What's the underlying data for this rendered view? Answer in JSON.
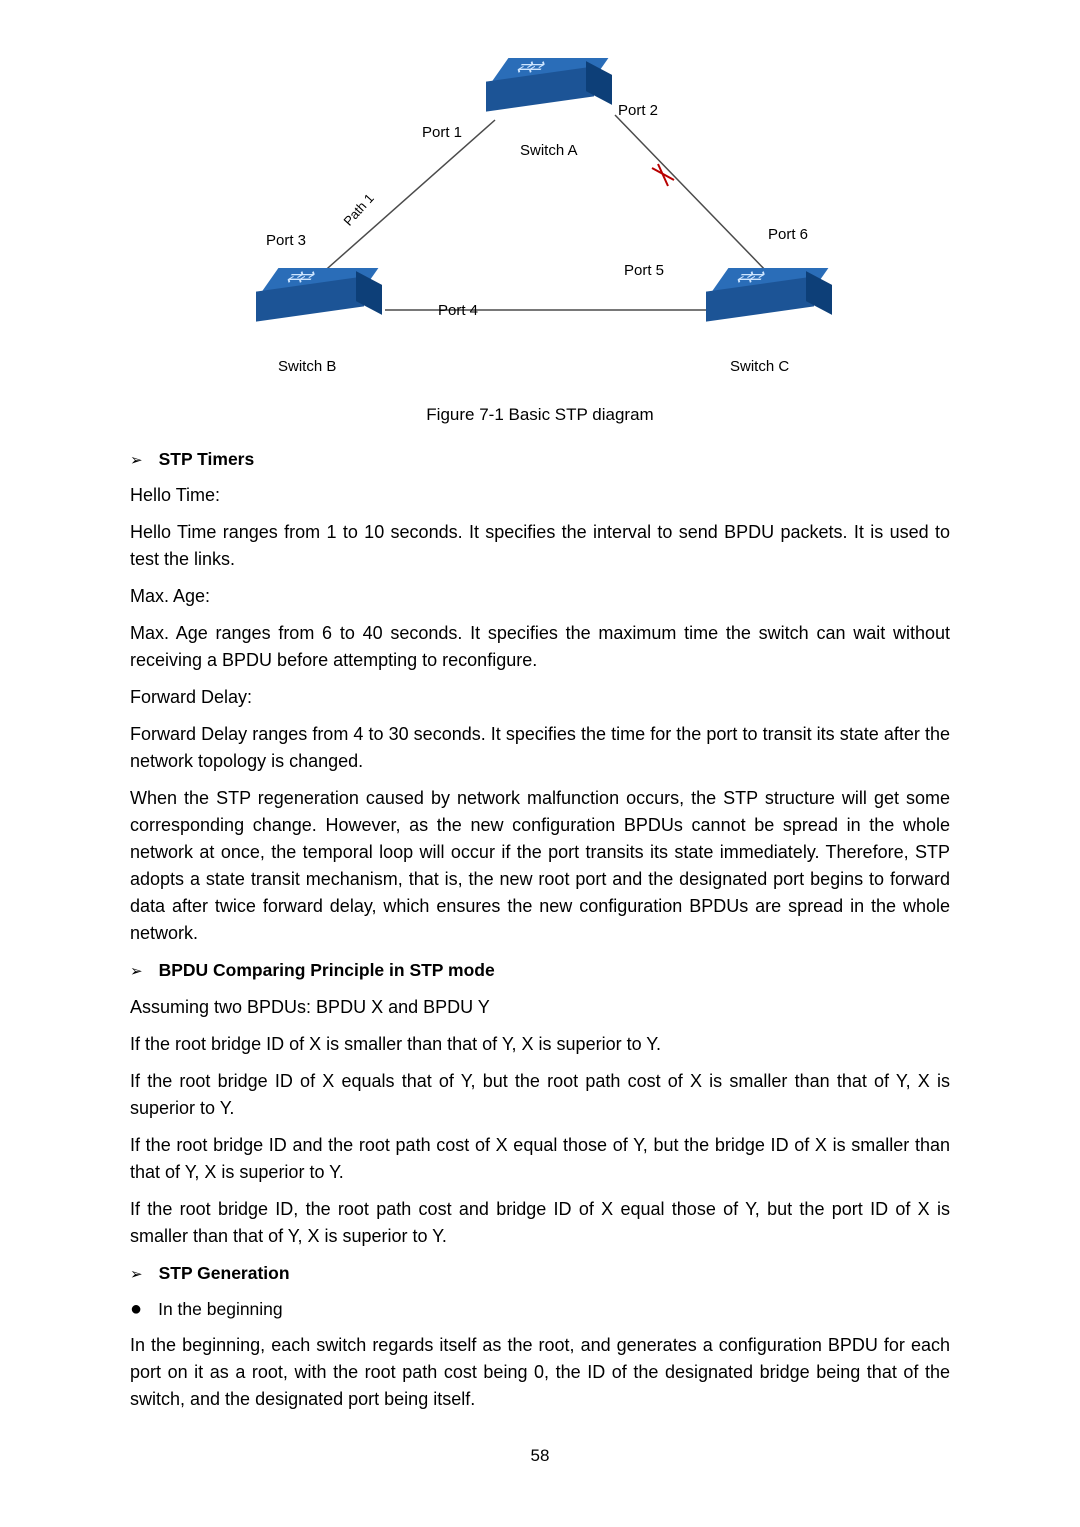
{
  "diagram": {
    "port1": "Port 1",
    "port2": "Port 2",
    "port3": "Port 3",
    "port4": "Port 4",
    "port5": "Port 5",
    "port6": "Port 6",
    "switchA": "Switch A",
    "switchB": "Switch B",
    "switchC": "Switch C",
    "path1": "Path 1"
  },
  "caption": "Figure 7-1 Basic STP diagram",
  "sec1": {
    "heading": "STP Timers",
    "hello_label": "Hello Time:",
    "hello_text": "Hello Time ranges from 1 to 10 seconds. It specifies the interval to send BPDU packets. It is used to test the links.",
    "maxage_label": "Max. Age:",
    "maxage_text": "Max. Age ranges from 6 to 40 seconds. It specifies the maximum time the switch can wait without receiving a BPDU before attempting to reconfigure.",
    "fwd_label": "Forward Delay:",
    "fwd_text": "Forward Delay ranges from 4 to 30 seconds. It specifies the time for the port to transit its state after the network topology is changed.",
    "expl": "When the STP regeneration caused by network malfunction occurs, the STP structure will get some corresponding change. However, as the new configuration BPDUs cannot be spread in the whole network at once, the temporal loop will occur if the port transits its state immediately. Therefore, STP adopts a state transit mechanism, that is, the new root port and the designated port begins to forward data after twice forward delay, which ensures the new configuration BPDUs are spread in the whole network."
  },
  "sec2": {
    "heading": "BPDU Comparing Principle in STP mode",
    "assume": "Assuming two BPDUs: BPDU X and BPDU Y",
    "r1": "If the root bridge ID of X is smaller than that of Y, X is superior to Y.",
    "r2": "If the root bridge ID of X equals that of Y, but the root path cost of X is smaller than that of Y, X is superior to Y.",
    "r3": "If the root bridge ID and the root path cost of X equal those of Y, but the bridge ID of X is smaller than that of Y, X is superior to Y.",
    "r4": "If the root bridge ID, the root path cost and bridge ID of X equal those of Y, but the port ID of X is smaller than that of Y, X is superior to Y."
  },
  "sec3": {
    "heading": "STP Generation",
    "sub1_label": "In the beginning",
    "sub1_text": "In the beginning, each switch regards itself as the root, and generates a configuration BPDU for each port on it as a root, with the root path cost being 0, the ID of the designated bridge being that of the switch, and the designated port being itself."
  },
  "page": "58"
}
